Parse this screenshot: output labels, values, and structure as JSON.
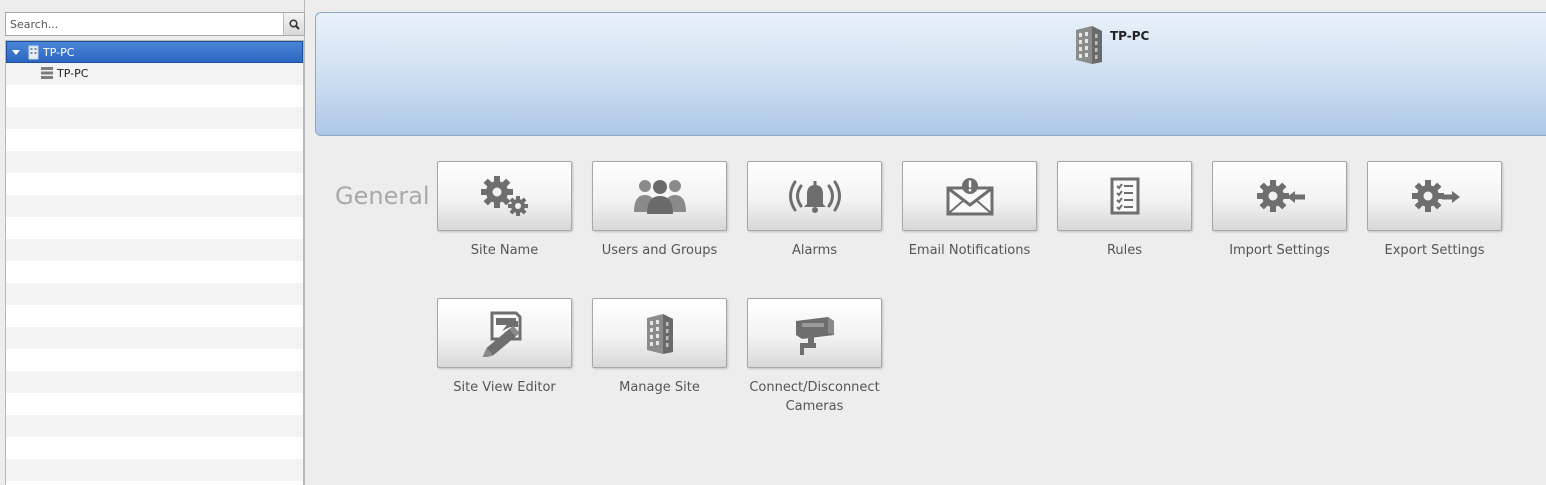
{
  "sidebar": {
    "search": {
      "placeholder": "Search..."
    },
    "tree": [
      {
        "label": "TP-PC",
        "icon": "building-icon",
        "selected": true,
        "expanded": true
      },
      {
        "label": "TP-PC",
        "icon": "server-icon",
        "selected": false
      }
    ]
  },
  "banner": {
    "title": "TP-PC",
    "icon": "building-icon"
  },
  "section": {
    "title": "General",
    "tiles": [
      {
        "label": "Site Name",
        "icon": "gears-icon"
      },
      {
        "label": "Users and Groups",
        "icon": "users-icon"
      },
      {
        "label": "Alarms",
        "icon": "alarm-bell-icon"
      },
      {
        "label": "Email Notifications",
        "icon": "email-alert-icon"
      },
      {
        "label": "Rules",
        "icon": "checklist-icon"
      },
      {
        "label": "Import Settings",
        "icon": "gear-import-icon"
      },
      {
        "label": "Export Settings",
        "icon": "gear-export-icon"
      },
      {
        "label": "Site View Editor",
        "icon": "pencil-editor-icon"
      },
      {
        "label": "Manage Site",
        "icon": "building-icon"
      },
      {
        "label": "Connect/Disconnect Cameras",
        "icon": "camera-icon"
      }
    ]
  },
  "colors": {
    "selection": "#2c66c0",
    "icon_gray": "#6e6e6e",
    "banner_top": "#e9f1fa",
    "banner_bottom": "#aec8e8"
  }
}
